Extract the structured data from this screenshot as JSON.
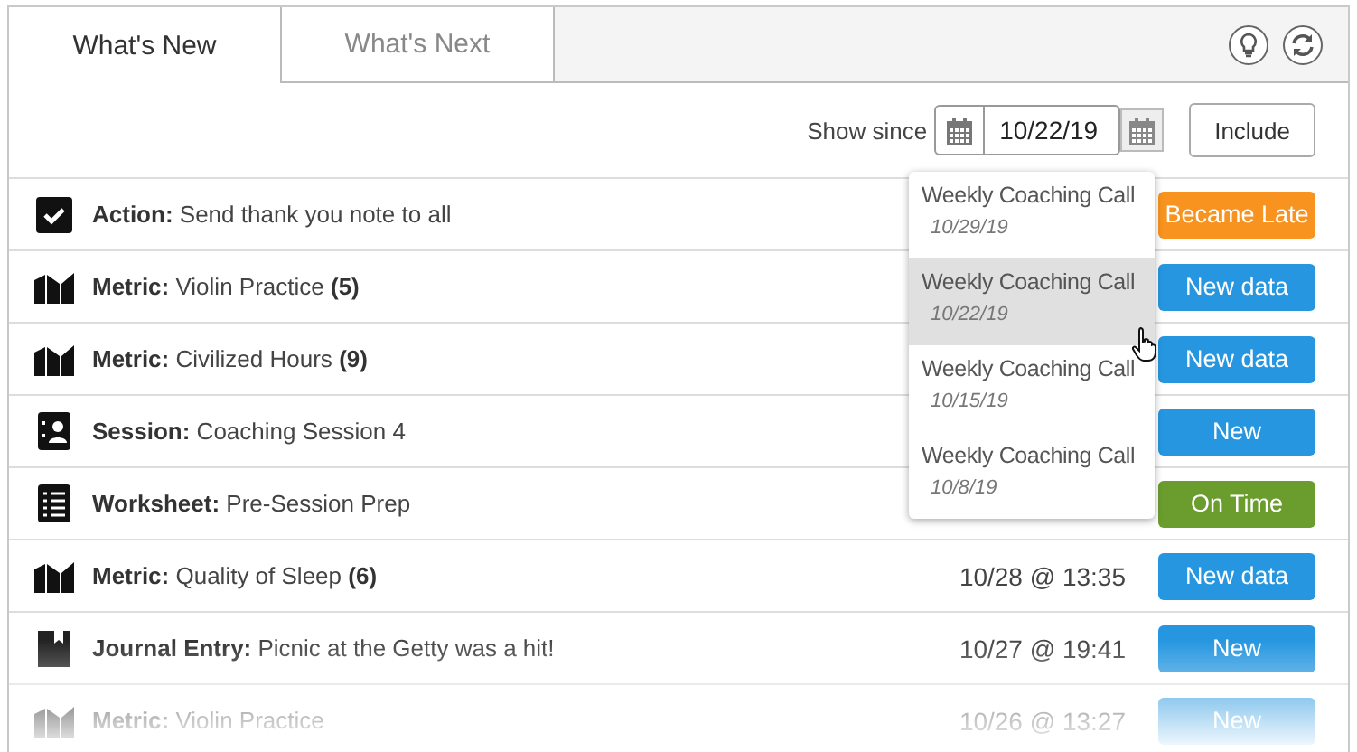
{
  "tabs": [
    {
      "label": "What's New",
      "selected": true
    },
    {
      "label": "What's Next",
      "selected": false
    }
  ],
  "filter": {
    "label": "Show since",
    "date": "10/22/19",
    "button": "Include"
  },
  "rows": [
    {
      "kind": "action",
      "type_label": "Action:",
      "title": "Send thank you note to all",
      "status": {
        "kind": "late",
        "label": "Became Late"
      }
    },
    {
      "kind": "metric",
      "type_label": "Metric:",
      "title": "Violin Practice",
      "count": "(5)",
      "status": {
        "kind": "new",
        "label": "New data"
      }
    },
    {
      "kind": "metric",
      "type_label": "Metric:",
      "title": "Civilized Hours",
      "count": "(9)",
      "status": {
        "kind": "new",
        "label": "New data"
      }
    },
    {
      "kind": "session",
      "type_label": "Session:",
      "title": "Coaching Session 4",
      "status": {
        "kind": "new",
        "label": "New"
      }
    },
    {
      "kind": "worksheet",
      "type_label": "Worksheet:",
      "title": "Pre-Session Prep",
      "status": {
        "kind": "ontime",
        "label": "On Time"
      }
    },
    {
      "kind": "metric",
      "type_label": "Metric:",
      "title": "Quality of Sleep",
      "count": "(6)",
      "time": "10/28 @ 13:35",
      "status": {
        "kind": "new",
        "label": "New data"
      }
    },
    {
      "kind": "journal",
      "type_label": "Journal Entry:",
      "title": "Picnic at the Getty was a hit!",
      "time": "10/27 @ 19:41",
      "status": {
        "kind": "new",
        "label": "New"
      }
    },
    {
      "kind": "metric",
      "type_label": "Metric:",
      "title": "Violin Practice",
      "time": "10/26 @ 13:27",
      "status": {
        "kind": "new",
        "label": "New"
      }
    }
  ],
  "dropdown": [
    {
      "title": "Weekly Coaching Call",
      "date": "10/29/19",
      "selected": false
    },
    {
      "title": "Weekly Coaching Call",
      "date": "10/22/19",
      "selected": true
    },
    {
      "title": "Weekly Coaching Call",
      "date": "10/15/19",
      "selected": false
    },
    {
      "title": "Weekly Coaching Call",
      "date": "10/8/19",
      "selected": false
    }
  ]
}
